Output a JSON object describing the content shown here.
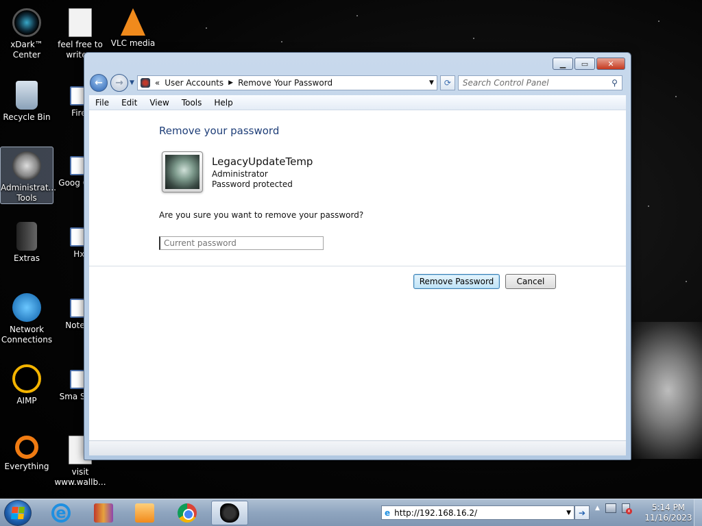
{
  "desktop_icons": [
    {
      "label": "xDark™ Center",
      "icon": "xdark-icon"
    },
    {
      "label": "feel free to write a",
      "icon": "document-icon"
    },
    {
      "label": "VLC media",
      "icon": "vlc-icon"
    },
    {
      "label": "Recycle Bin",
      "icon": "recycle-bin-icon"
    },
    {
      "label": "Firef",
      "icon": "firefox-icon"
    },
    {
      "label": "Administrat... Tools",
      "icon": "admin-tools-icon"
    },
    {
      "label": "Goog Chro",
      "icon": "chrome-icon"
    },
    {
      "label": "Extras",
      "icon": "folder-icon"
    },
    {
      "label": "Hxl",
      "icon": "app-icon"
    },
    {
      "label": "Network Connections",
      "icon": "network-icon"
    },
    {
      "label": "Notepa",
      "icon": "notepad-icon"
    },
    {
      "label": "AIMP",
      "icon": "aimp-icon"
    },
    {
      "label": "Sma Servi",
      "icon": "app-icon"
    },
    {
      "label": "Everything",
      "icon": "everything-icon"
    },
    {
      "label": "visit www.wallb...",
      "icon": "document-icon"
    }
  ],
  "window": {
    "breadcrumb_prefix": "«",
    "breadcrumb": [
      "User Accounts",
      "Remove Your Password"
    ],
    "search_placeholder": "Search Control Panel",
    "menu": [
      "File",
      "Edit",
      "View",
      "Tools",
      "Help"
    ],
    "page_title": "Remove your password",
    "user": {
      "name": "LegacyUpdateTemp",
      "role": "Administrator",
      "status": "Password protected"
    },
    "question": "Are you sure you want to remove your password?",
    "password_placeholder": "Current password",
    "remove_button": "Remove Password",
    "cancel_button": "Cancel"
  },
  "taskbar": {
    "address": "http://192.168.16.2/",
    "time": "5:14 PM",
    "date": "11/16/2023",
    "pinned": [
      "internet-explorer-icon",
      "archive-icon",
      "media-player-icon",
      "chrome-icon",
      "control-panel-icon"
    ]
  },
  "colors": {
    "title_blue": "#1e3e78",
    "taskbar": "#8fa5bf",
    "window_frame": "#b1c8e2"
  }
}
